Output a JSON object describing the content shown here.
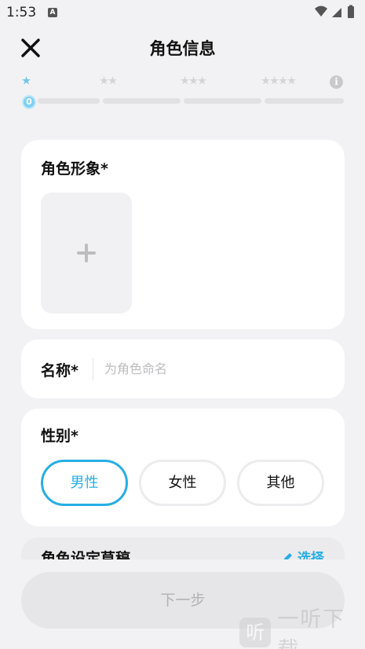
{
  "status_bar": {
    "time": "1:53",
    "notification_letter": "A"
  },
  "header": {
    "title": "角色信息"
  },
  "progress": {
    "level": "0",
    "info_glyph": "i",
    "stages": [
      1,
      2,
      3,
      4
    ]
  },
  "appearance": {
    "title": "角色形象*"
  },
  "name": {
    "label": "名称*",
    "placeholder": "为角色命名",
    "value": ""
  },
  "gender": {
    "title": "性别*",
    "options": [
      "男性",
      "女性",
      "其他"
    ],
    "selected": "男性"
  },
  "draft": {
    "title": "角色设定草稿",
    "select_label": "选择"
  },
  "footer": {
    "next_label": "下一步"
  },
  "watermark": {
    "logo_char": "听",
    "text": "一听下载"
  },
  "colors": {
    "accent": "#27aee4",
    "background": "#f2f2f4",
    "star_active": "#6cc6ee",
    "star_inactive": "#d4d4d7"
  }
}
